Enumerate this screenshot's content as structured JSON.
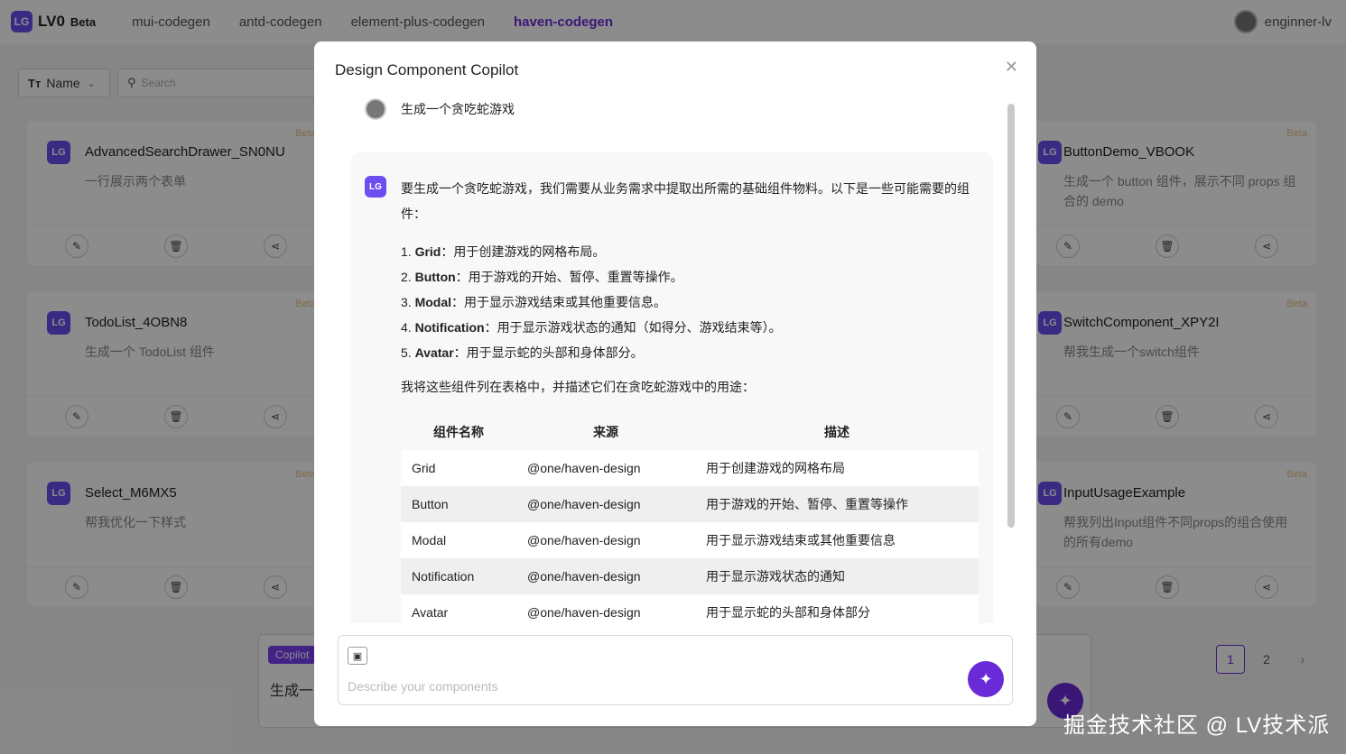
{
  "app": {
    "logo_mark": "LG",
    "name": "LV0",
    "badge": "Beta"
  },
  "nav": [
    {
      "label": "mui-codegen"
    },
    {
      "label": "antd-codegen"
    },
    {
      "label": "element-plus-codegen"
    },
    {
      "label": "haven-codegen",
      "active": true
    }
  ],
  "user": {
    "name": "enginner-lv"
  },
  "toolbar": {
    "filter_label": "Name",
    "filter_icon": "Tт",
    "search_placeholder": "Search"
  },
  "cards": [
    {
      "title": "AdvancedSearchDrawer_SN0NU",
      "desc": "一行展示两个表单",
      "badge": "Beta"
    },
    {
      "title": "ButtonDemo_VBOOK",
      "desc": "生成一个 button 组件，展示不同 props 组合的 demo",
      "badge": "Beta"
    },
    {
      "title": "TodoList_4OBN8",
      "desc": "生成一个 TodoList 组件",
      "badge": "Beta"
    },
    {
      "title": "SwitchComponent_XPY2I",
      "desc": "帮我生成一个switch组件",
      "badge": "Beta"
    },
    {
      "title": "Select_M6MX5",
      "desc": "帮我优化一下样式",
      "badge": "Beta"
    },
    {
      "title": "InputUsageExample",
      "desc": "帮我列出Input组件不同props的组合使用的所有demo",
      "badge": "Beta"
    }
  ],
  "copilot": {
    "tag": "Copilot",
    "text": "生成一"
  },
  "pagination": {
    "pages": [
      "1",
      "2"
    ],
    "current": "1"
  },
  "modal": {
    "title": "Design Component Copilot",
    "user_message": "生成一个贪吃蛇游戏",
    "ai": {
      "intro": "要生成一个贪吃蛇游戏，我们需要从业务需求中提取出所需的基础组件物料。以下是一些可能需要的组件：",
      "items": [
        {
          "num": "1.",
          "name": "Grid",
          "desc": "：用于创建游戏的网格布局。"
        },
        {
          "num": "2.",
          "name": "Button",
          "desc": "：用于游戏的开始、暂停、重置等操作。"
        },
        {
          "num": "3.",
          "name": "Modal",
          "desc": "：用于显示游戏结束或其他重要信息。"
        },
        {
          "num": "4.",
          "name": "Notification",
          "desc": "：用于显示游戏状态的通知（如得分、游戏结束等）。"
        },
        {
          "num": "5.",
          "name": "Avatar",
          "desc": "：用于显示蛇的头部和身体部分。"
        }
      ],
      "note": "我将这些组件列在表格中，并描述它们在贪吃蛇游戏中的用途：",
      "table": {
        "headers": [
          "组件名称",
          "来源",
          "描述"
        ],
        "rows": [
          [
            "Grid",
            "@one/haven-design",
            "用于创建游戏的网格布局"
          ],
          [
            "Button",
            "@one/haven-design",
            "用于游戏的开始、暂停、重置等操作"
          ],
          [
            "Modal",
            "@one/haven-design",
            "用于显示游戏结束或其他重要信息"
          ],
          [
            "Notification",
            "@one/haven-design",
            "用于显示游戏状态的通知"
          ],
          [
            "Avatar",
            "@one/haven-design",
            "用于显示蛇的头部和身体部分"
          ]
        ]
      }
    },
    "input_placeholder": "Describe your components"
  },
  "watermark": "掘金技术社区 @ LV技术派",
  "colors": {
    "accent": "#6a2ad8",
    "badge": "#e4c188",
    "mask": "rgba(0,0,0,0.45)"
  },
  "icons": [
    "edit-icon",
    "delete-icon",
    "share-icon",
    "close-icon",
    "image-icon",
    "magic-wand-icon",
    "search-icon",
    "chevron-down-icon",
    "chevron-right-icon",
    "text-size-icon"
  ]
}
